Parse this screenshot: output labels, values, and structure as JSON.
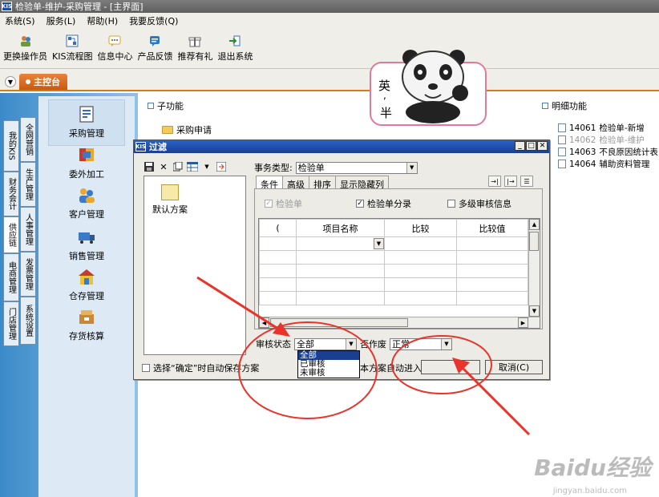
{
  "window": {
    "title": "检验单-维护-采购管理 - [主界面]",
    "logo_text": "KIS"
  },
  "menu": [
    "系统(S)",
    "服务(L)",
    "帮助(H)",
    "我要反馈(Q)"
  ],
  "toolbar": [
    {
      "label": "更换操作员",
      "icon": "user-switch-icon"
    },
    {
      "label": "KIS流程图",
      "icon": "flowchart-icon"
    },
    {
      "label": "信息中心",
      "icon": "message-icon"
    },
    {
      "label": "产品反馈",
      "icon": "feedback-icon"
    },
    {
      "label": "推荐有礼",
      "icon": "gift-icon"
    },
    {
      "label": "退出系统",
      "icon": "exit-icon"
    }
  ],
  "console_tab": "主控台",
  "vertical_tabs": [
    "我的KIS",
    "财务会计",
    "供应链",
    "电商管理",
    "门店管理",
    "全网营销",
    "生产管理",
    "人事管理",
    "发票管理",
    "系统设置"
  ],
  "modules": [
    "采购管理",
    "委外加工",
    "客户管理",
    "销售管理",
    "仓存管理",
    "存货核算"
  ],
  "sub_function": {
    "header": "子功能",
    "items": [
      "采购申请"
    ]
  },
  "detail_function": {
    "header": "明细功能",
    "items": [
      {
        "code": "14061",
        "name": "检验单-新增"
      },
      {
        "code": "14062",
        "name": "检验单-维护"
      },
      {
        "code": "14063",
        "name": "不良原因统计表"
      },
      {
        "code": "14064",
        "name": "辅助资料管理"
      }
    ]
  },
  "sticker": {
    "chars": [
      "英",
      ",",
      "半"
    ]
  },
  "dialog": {
    "title": "过滤",
    "scheme_default": "默认方案",
    "biz_type_label": "事务类型:",
    "biz_type_value": "检验单",
    "tabs": [
      "条件",
      "高级",
      "排序",
      "显示隐藏列"
    ],
    "chk_inspect": "检验单",
    "chk_inspect_entries": "检验单分录",
    "chk_multi_audit": "多级审核信息",
    "grid_headers": [
      "(",
      "项目名称",
      "比较",
      "比较值"
    ],
    "audit_label": "审核状态",
    "audit_value": "全部",
    "audit_options": [
      "全部",
      "已审核",
      "未审核"
    ],
    "void_label": "否作废",
    "void_value": "正常",
    "auto_save": "选择“确定”时自动保存方案",
    "auto_enter": "本方案自动进入",
    "cancel": "取消(C)"
  },
  "watermark": {
    "brand": "Baidu经验",
    "url": "jingyan.baidu.com"
  }
}
